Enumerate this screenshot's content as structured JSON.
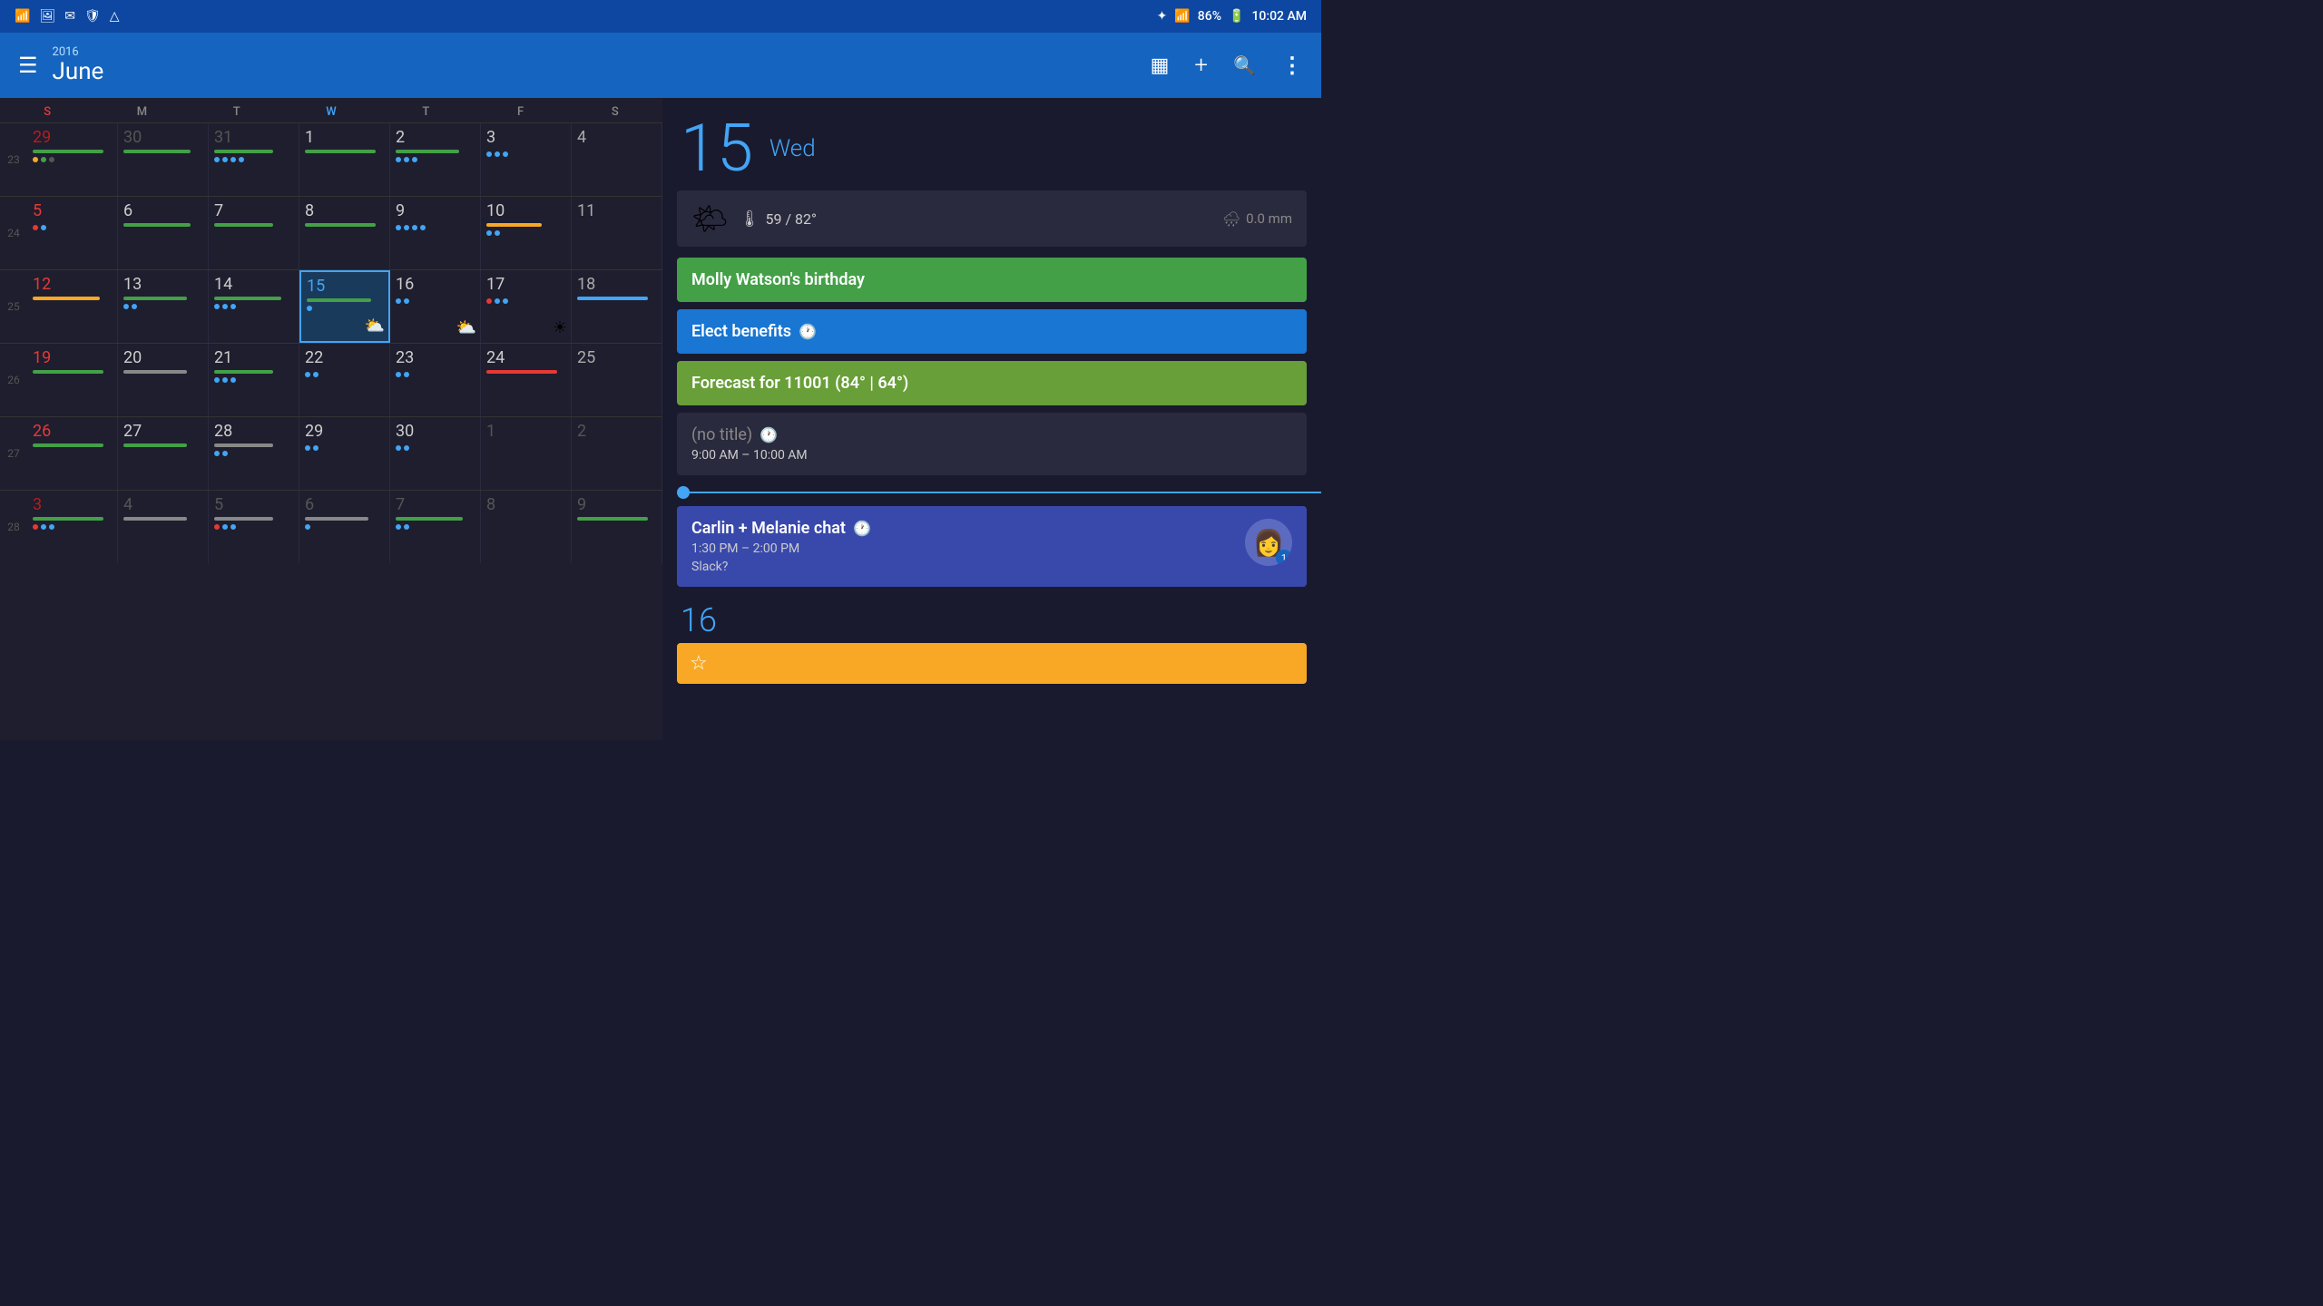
{
  "statusBar": {
    "time": "10:02 AM",
    "battery": "86%",
    "signal": "●●●●",
    "wifi": "WiFi",
    "bluetooth": "BT"
  },
  "topBar": {
    "year": "2016",
    "month": "June",
    "hamburgerLabel": "☰",
    "calendarIcon": "▦",
    "addIcon": "+",
    "searchIcon": "🔍",
    "moreIcon": "⋮"
  },
  "dayHeaders": [
    "S",
    "M",
    "T",
    "W",
    "T",
    "F",
    "S"
  ],
  "weeks": [
    {
      "weekNum": "23",
      "days": [
        {
          "date": "29",
          "type": "sunday",
          "otherMonth": true
        },
        {
          "date": "30",
          "type": "normal",
          "otherMonth": true
        },
        {
          "date": "31",
          "type": "normal",
          "otherMonth": true
        },
        {
          "date": "1",
          "type": "normal"
        },
        {
          "date": "2",
          "type": "normal"
        },
        {
          "date": "3",
          "type": "normal"
        },
        {
          "date": "4",
          "type": "saturday"
        }
      ]
    },
    {
      "weekNum": "24",
      "days": [
        {
          "date": "5",
          "type": "sunday"
        },
        {
          "date": "6",
          "type": "normal"
        },
        {
          "date": "7",
          "type": "normal"
        },
        {
          "date": "8",
          "type": "normal"
        },
        {
          "date": "9",
          "type": "normal"
        },
        {
          "date": "10",
          "type": "normal"
        },
        {
          "date": "11",
          "type": "saturday"
        }
      ]
    },
    {
      "weekNum": "25",
      "days": [
        {
          "date": "12",
          "type": "sunday"
        },
        {
          "date": "13",
          "type": "normal"
        },
        {
          "date": "14",
          "type": "normal"
        },
        {
          "date": "15",
          "type": "today"
        },
        {
          "date": "16",
          "type": "normal"
        },
        {
          "date": "17",
          "type": "normal"
        },
        {
          "date": "18",
          "type": "saturday"
        }
      ]
    },
    {
      "weekNum": "26",
      "days": [
        {
          "date": "19",
          "type": "sunday"
        },
        {
          "date": "20",
          "type": "normal"
        },
        {
          "date": "21",
          "type": "normal"
        },
        {
          "date": "22",
          "type": "normal"
        },
        {
          "date": "23",
          "type": "normal"
        },
        {
          "date": "24",
          "type": "normal"
        },
        {
          "date": "25",
          "type": "saturday"
        }
      ]
    },
    {
      "weekNum": "27",
      "days": [
        {
          "date": "26",
          "type": "sunday"
        },
        {
          "date": "27",
          "type": "normal"
        },
        {
          "date": "28",
          "type": "normal"
        },
        {
          "date": "29",
          "type": "normal"
        },
        {
          "date": "30",
          "type": "normal"
        },
        {
          "date": "1",
          "type": "normal",
          "otherMonth": true
        },
        {
          "date": "2",
          "type": "saturday",
          "otherMonth": true
        }
      ]
    },
    {
      "weekNum": "28",
      "days": [
        {
          "date": "3",
          "type": "sunday",
          "otherMonth": true
        },
        {
          "date": "4",
          "type": "normal",
          "otherMonth": true
        },
        {
          "date": "5",
          "type": "normal",
          "otherMonth": true
        },
        {
          "date": "6",
          "type": "normal",
          "otherMonth": true
        },
        {
          "date": "7",
          "type": "normal",
          "otherMonth": true
        },
        {
          "date": "8",
          "type": "normal",
          "otherMonth": true
        },
        {
          "date": "9",
          "type": "saturday",
          "otherMonth": true
        }
      ]
    }
  ],
  "selectedDate": {
    "number": "15",
    "dayName": "Wed"
  },
  "weather": {
    "icon": "🌤",
    "temp": "59 / 82°",
    "precip": "0.0 mm"
  },
  "events": [
    {
      "id": "birthday",
      "title": "Molly Watson's birthday",
      "type": "green",
      "hasClock": false
    },
    {
      "id": "benefits",
      "title": "Elect benefits",
      "type": "blue",
      "hasClock": true
    },
    {
      "id": "forecast",
      "title": "Forecast for 11001 (84° | 64°)",
      "type": "olive",
      "hasClock": false
    },
    {
      "id": "no-title",
      "title": "(no title)",
      "type": "dark",
      "hasClock": true,
      "timeRange": "9:00 AM – 10:00 AM"
    }
  ],
  "timeIndicator": {
    "show": true
  },
  "carlinEvent": {
    "title": "Carlin + Melanie chat",
    "hasClock": true,
    "timeRange": "1:30 PM – 2:00 PM",
    "subtitle": "Slack?",
    "badgeCount": "1"
  },
  "nextDay": {
    "number": "16",
    "eventTitle": "☆",
    "eventColor": "#f9a825"
  }
}
